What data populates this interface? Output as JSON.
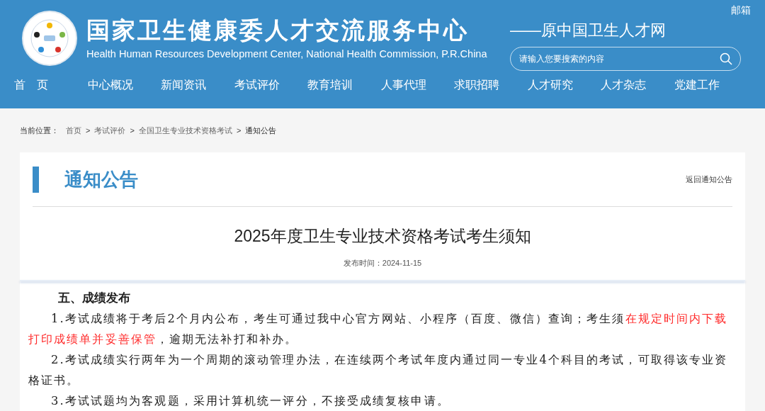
{
  "header": {
    "title": "国家卫生健康委人才交流服务中心",
    "subtitle": "Health Human Resources Development Center, National Health Commission, P.R.China",
    "former_name": "——原中国卫生人才网",
    "mail_link": "邮箱",
    "search": {
      "placeholder": "请输入您要搜索的内容"
    }
  },
  "nav": [
    {
      "label": "首　页"
    },
    {
      "label": "中心概况"
    },
    {
      "label": "新闻资讯"
    },
    {
      "label": "考试评价"
    },
    {
      "label": "教育培训"
    },
    {
      "label": "人事代理"
    },
    {
      "label": "求职招聘"
    },
    {
      "label": "人才研究"
    },
    {
      "label": "人才杂志"
    },
    {
      "label": "党建工作"
    }
  ],
  "breadcrumb": {
    "label": "当前位置：",
    "items": [
      "首页",
      "考试评价",
      "全国卫生专业技术资格考试",
      "通知公告"
    ],
    "separator": ">"
  },
  "section": {
    "title": "通知公告",
    "back_link": "返回通知公告"
  },
  "article": {
    "title": "2025年度卫生专业技术资格考试考生须知",
    "date": "发布时间：2024-11-15",
    "heading": "五、成绩发布",
    "paragraphs": [
      [
        {
          "text": "1.考试成绩将于考后2个月内公布，考生可通过我中心官方网站、小程序（百度、微信）查询；考生须",
          "highlight": false
        },
        {
          "text": "在规定时间内下载打印成绩单并妥善保管",
          "highlight": true
        },
        {
          "text": "，逾期无法补打和补办。",
          "highlight": false
        }
      ],
      [
        {
          "text": "2.考试成绩实行两年为一个周期的滚动管理办法，在连续两个考试年度内通过同一专业4个科目的考试，可取得该专业资格证书。",
          "highlight": false
        }
      ],
      [
        {
          "text": "3.考试试题均为客观题，采用计算机统一评分，不接受成绩复核申请。",
          "highlight": false
        }
      ]
    ]
  }
}
